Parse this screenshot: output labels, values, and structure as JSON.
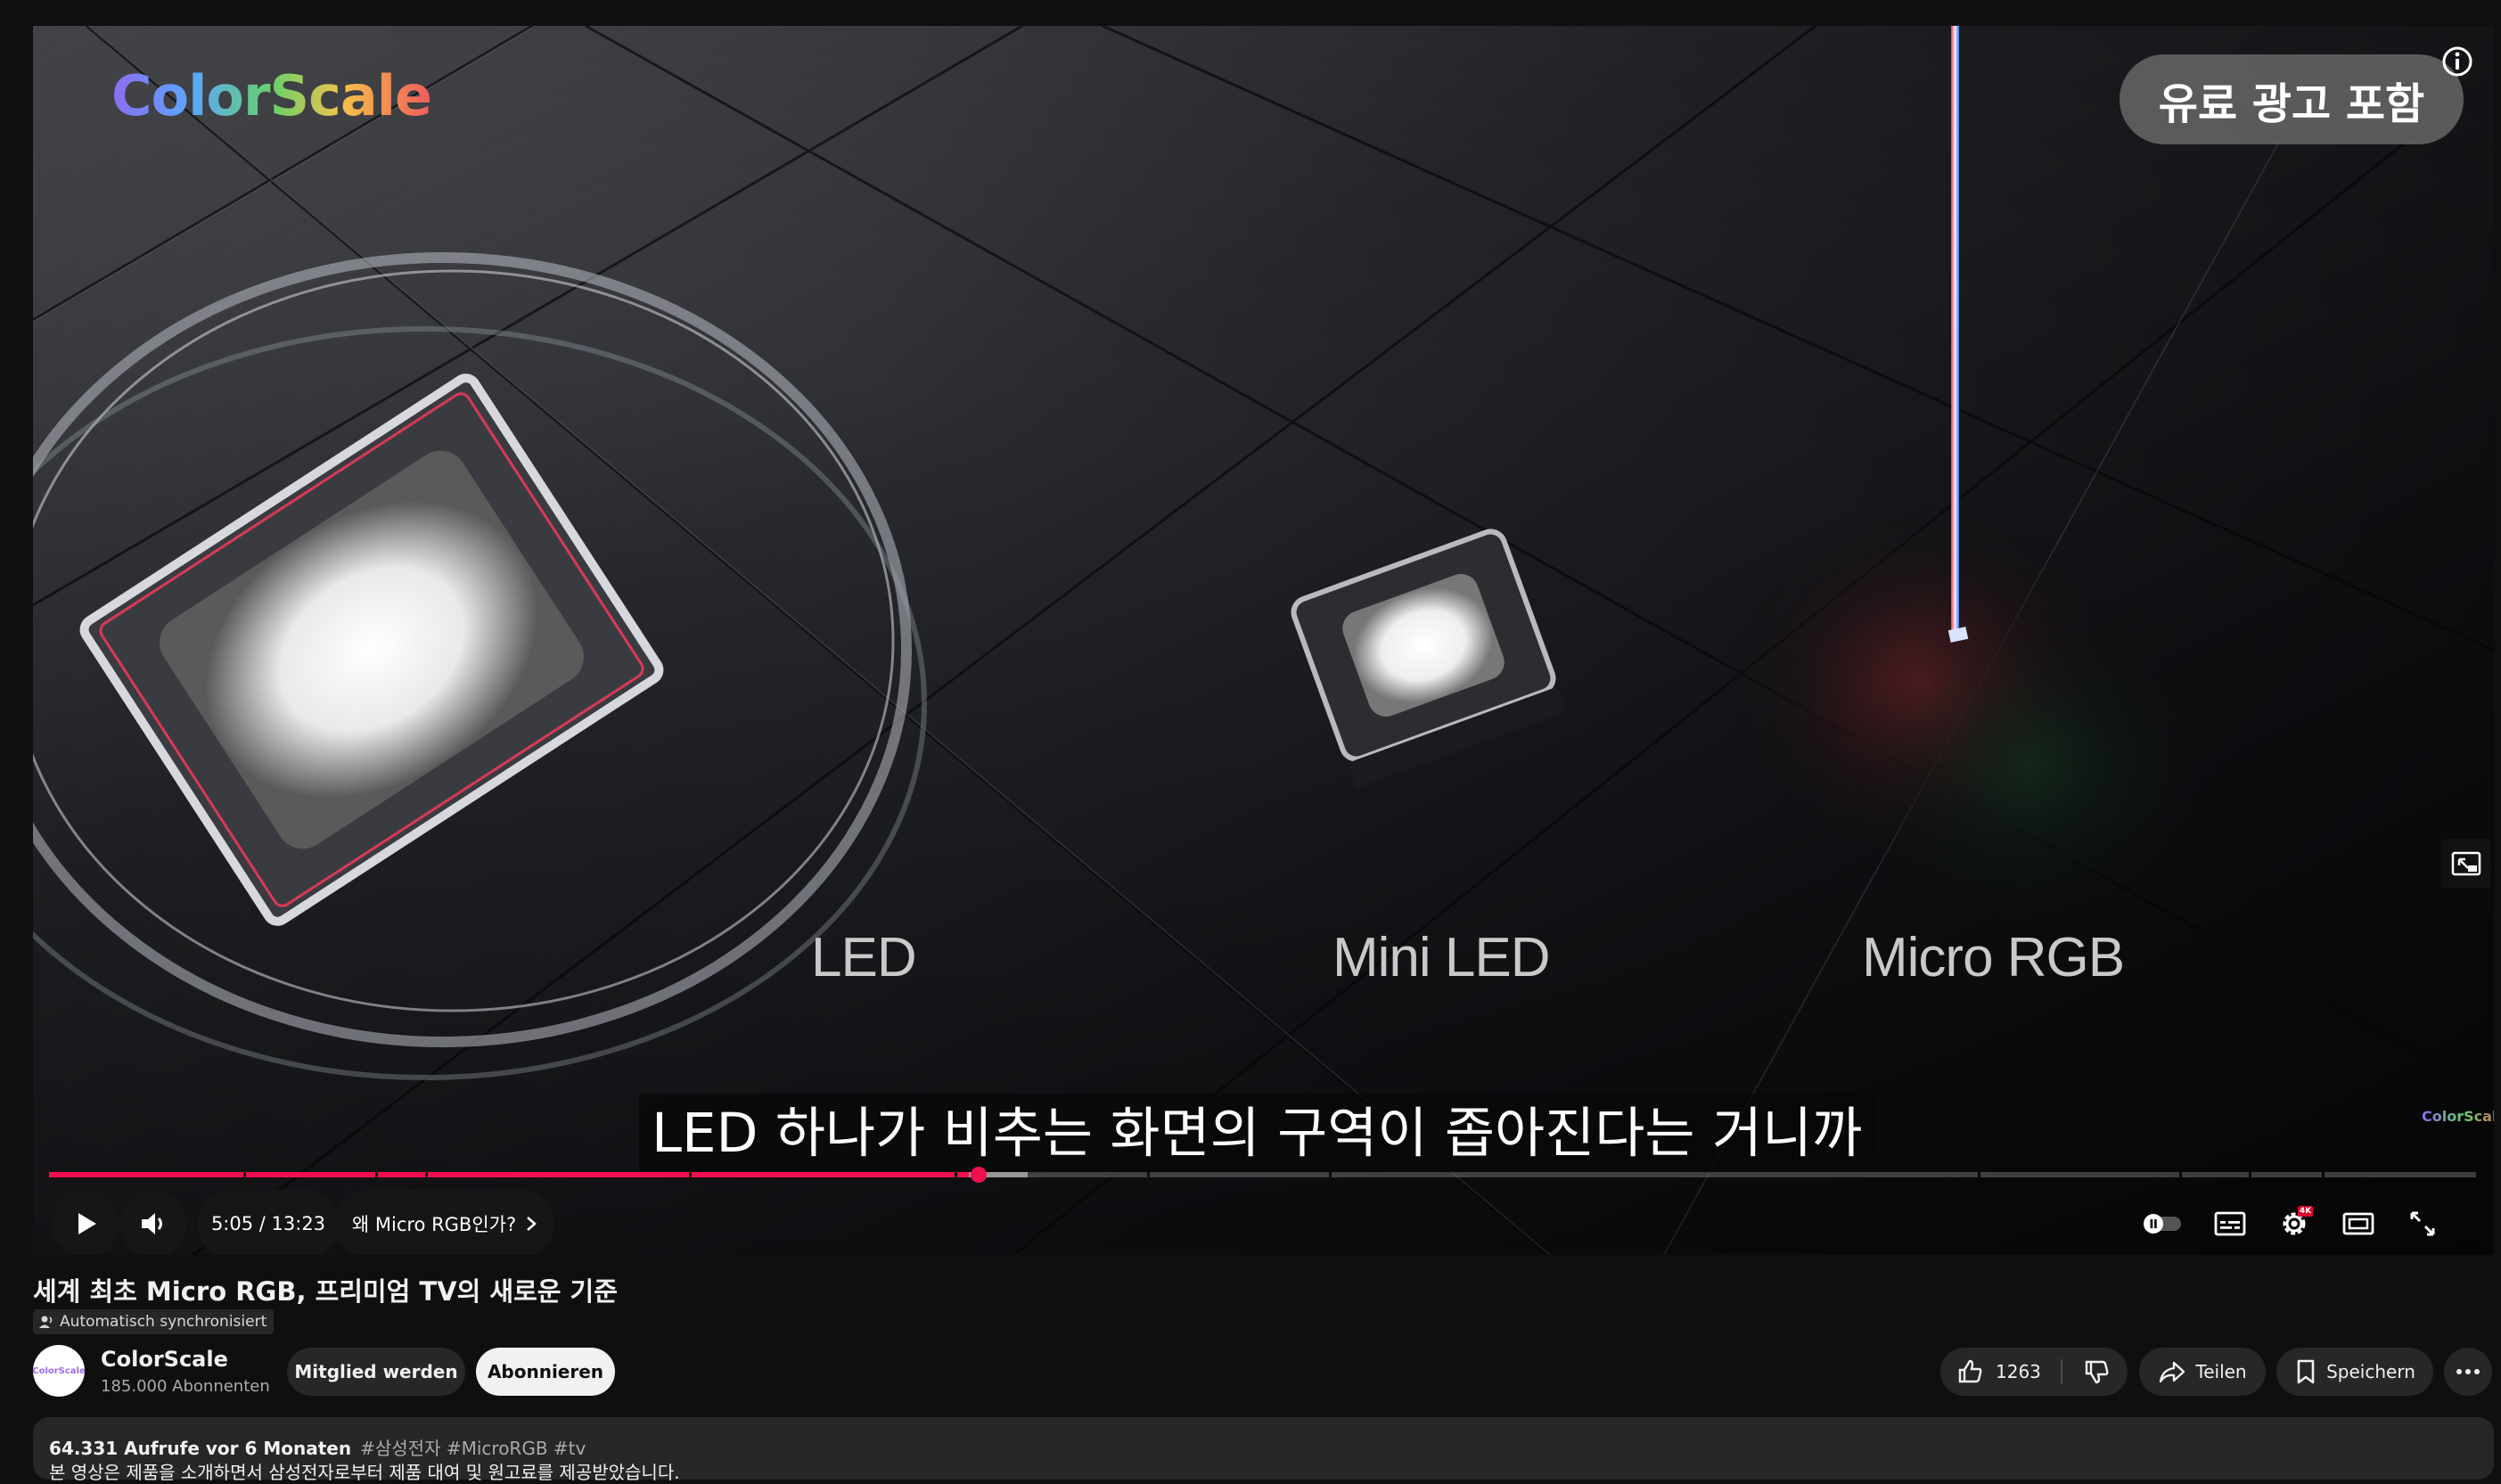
{
  "player": {
    "brand_logo": "ColorScale",
    "paid_promo_badge": "유료 광고 포함",
    "scene_labels": [
      "LED",
      "Mini LED",
      "Micro RGB"
    ],
    "watermark": "ColorScale",
    "caption": "LED 하나가 비추는 화면의 구역이 좁아진다는 거니까",
    "time_display": "5:05 / 13:23",
    "chapter_title": "왜 Micro RGB인가?",
    "quality_badge": "4K",
    "progress_fraction": 0.379,
    "icons": {
      "play": "play-icon",
      "volume": "volume-icon",
      "chevron": "chevron-right-icon",
      "autoplay": "autoplay-toggle-icon",
      "subtitles": "subtitles-icon",
      "settings": "settings-icon",
      "theater": "theater-mode-icon",
      "fullscreen": "fullscreen-icon",
      "miniplayer": "miniplayer-icon",
      "info": "info-icon"
    }
  },
  "video": {
    "title": "세계 최초 Micro RGB, 프리미엄 TV의 새로운 기준",
    "sync_badge": "Automatisch synchronisiert"
  },
  "channel": {
    "avatar_text": "ColorScale",
    "name": "ColorScale",
    "subscribers": "185.000 Abonnenten",
    "member_button": "Mitglied werden",
    "subscribe_button": "Abonnieren"
  },
  "actions": {
    "like_count": "1263",
    "share": "Teilen",
    "save": "Speichern"
  },
  "description": {
    "stats": "64.331 Aufrufe  vor 6 Monaten",
    "tags": "#삼성전자 #MicroRGB #tv",
    "first_line": "본 영상은 제품을 소개하면서 삼성전자로부터 제품 대여 및 원고료를 제공받았습니다."
  },
  "colors": {
    "accent_red": "#f10f4f",
    "background": "#0f0f0f",
    "chip_background": "#272727"
  }
}
